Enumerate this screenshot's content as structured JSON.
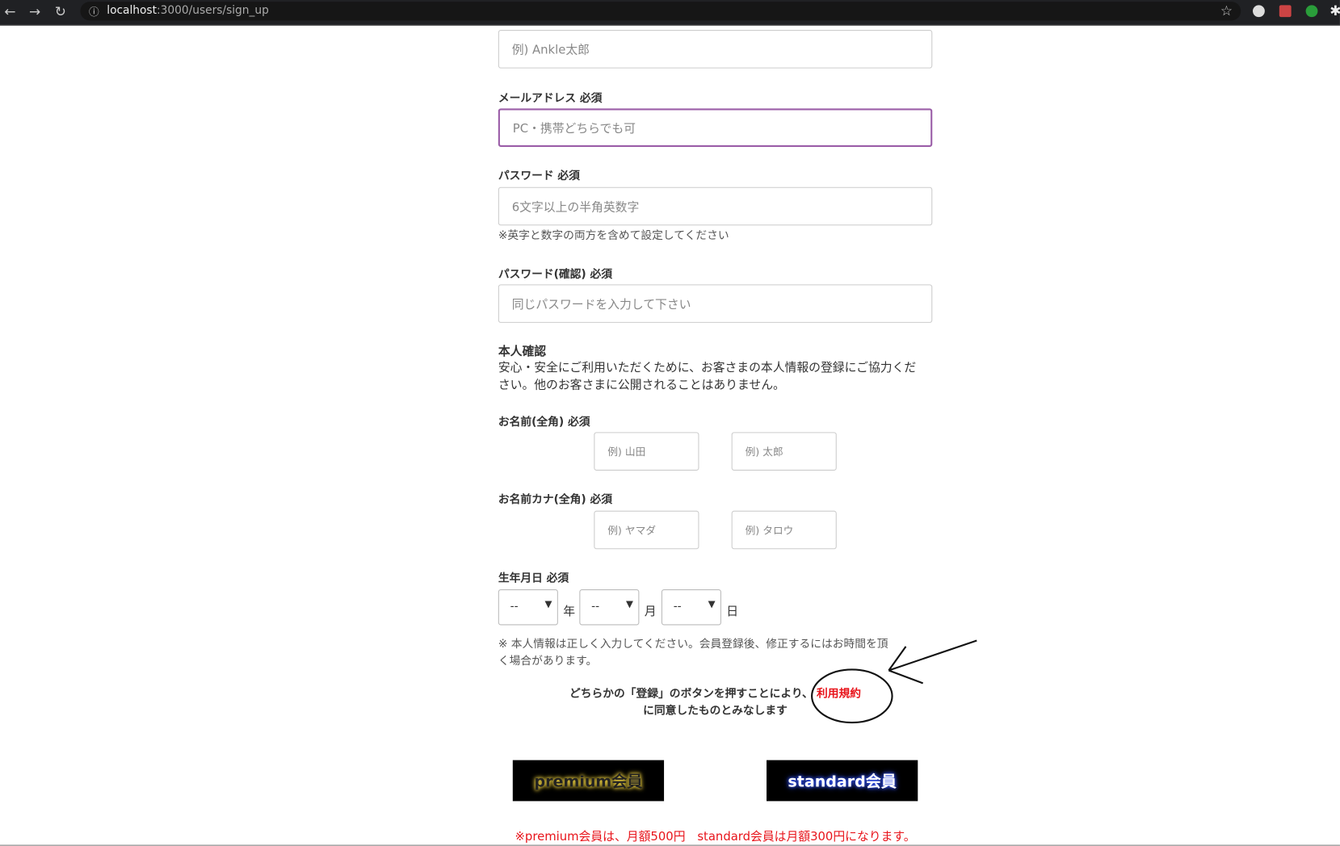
{
  "browser": {
    "url_host": "localhost",
    "url_path": ":3000/users/sign_up",
    "back_icon": "arrow-left-icon",
    "forward_icon": "arrow-right-icon",
    "reload_icon": "reload-icon"
  },
  "form": {
    "nickname_placeholder": "例) Ankle太郎",
    "email_label": "メールアドレス 必須",
    "email_placeholder": "PC・携帯どちらでも可",
    "password_label": "パスワード 必須",
    "password_placeholder": "6文字以上の半角英数字",
    "password_note": "※英字と数字の両方を含めて設定してください",
    "password_confirm_label": "パスワード(確認) 必須",
    "password_confirm_placeholder": "同じパスワードを入力して下さい",
    "identity_heading": "本人確認",
    "identity_desc_1": "安心・安全にご利用いただくために、お客さまの本人情報の登録にご協力くだ",
    "identity_desc_2": "さい。他のお客さまに公開されることはありません。",
    "name_label": "お名前(全角) 必須",
    "last_name_placeholder": "例) 山田",
    "first_name_placeholder": "例) 太郎",
    "kana_label": "お名前カナ(全角) 必須",
    "last_kana_placeholder": "例) ヤマダ",
    "first_kana_placeholder": "例) タロウ",
    "birthday_label": "生年月日 必須",
    "year_value": "--",
    "year_unit": "年",
    "month_value": "--",
    "month_unit": "月",
    "day_value": "--",
    "day_unit": "日",
    "identity_note_1": "※ 本人情報は正しく入力してください。会員登録後、修正するにはお時間を頂",
    "identity_note_2": "く場合があります。",
    "agree_text_1": "どちらかの「登録」のボタンを押すことにより、",
    "terms_link": "利用規約",
    "agree_text_2": "に同意したものとみなします",
    "premium_button": "premium会員",
    "standard_button": "standard会員",
    "price_note": "※premium会員は、月額500円　standard会員は月額300円になります。"
  },
  "colors": {
    "accent_red": "#e8141b",
    "focus_border": "#9b5ea8",
    "premium_glow": "#f5d742",
    "standard_glow": "#3355ff"
  }
}
